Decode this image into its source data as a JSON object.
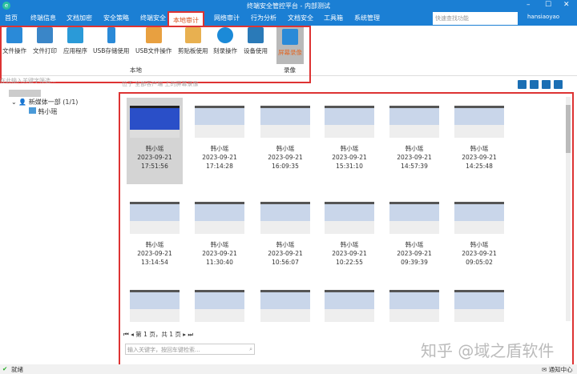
{
  "title": "终端安全管控平台 - 内部测试",
  "window_controls": [
    "–",
    "☐",
    "✕"
  ],
  "menu": [
    "首页",
    "终端信息",
    "文档加密",
    "安全策略",
    "终端安全",
    "本地审计",
    "网络审计",
    "行为分析",
    "文档安全",
    "工具箱",
    "系统管理"
  ],
  "active_menu": "本地审计",
  "search_placeholder": "快速查找功能",
  "user": "hansiaoyao",
  "ribbon": {
    "items": [
      {
        "label": "文件操作",
        "color": "#2a8ad8"
      },
      {
        "label": "文件打印",
        "color": "#3a86c8"
      },
      {
        "label": "应用程序",
        "color": "#2a9ad8"
      },
      {
        "label": "USB存储使用",
        "color": "#2a8ad8"
      },
      {
        "label": "USB文件操作",
        "color": "#e8a040"
      },
      {
        "label": "剪贴板使用",
        "color": "#e8b050"
      },
      {
        "label": "刻录操作",
        "color": "#1b8ad8"
      },
      {
        "label": "设备使用",
        "color": "#2a7ab8"
      }
    ],
    "groups": [
      "本地",
      "录像"
    ],
    "selected": "屏幕录像"
  },
  "filter_placeholder": "在此输入关键字筛选...",
  "breadcrumb": "位于 全部客户端 上的屏幕录像",
  "tree": {
    "group": "新媒体一部 (1/1)",
    "user": "韩小瑶"
  },
  "thumbnails": [
    {
      "name": "韩小瑶",
      "date": "2023-09-21",
      "time": "17:51:56"
    },
    {
      "name": "韩小瑶",
      "date": "2023-09-21",
      "time": "17:14:28"
    },
    {
      "name": "韩小瑶",
      "date": "2023-09-21",
      "time": "16:09:35"
    },
    {
      "name": "韩小瑶",
      "date": "2023-09-21",
      "time": "15:31:10"
    },
    {
      "name": "韩小瑶",
      "date": "2023-09-21",
      "time": "14:57:39"
    },
    {
      "name": "韩小瑶",
      "date": "2023-09-21",
      "time": "14:25:48"
    },
    {
      "name": "韩小瑶",
      "date": "2023-09-21",
      "time": "13:14:54"
    },
    {
      "name": "韩小瑶",
      "date": "2023-09-21",
      "time": "11:30:40"
    },
    {
      "name": "韩小瑶",
      "date": "2023-09-21",
      "time": "10:56:07"
    },
    {
      "name": "韩小瑶",
      "date": "2023-09-21",
      "time": "10:22:55"
    },
    {
      "name": "韩小瑶",
      "date": "2023-09-21",
      "time": "09:39:39"
    },
    {
      "name": "韩小瑶",
      "date": "2023-09-21",
      "time": "09:05:02"
    }
  ],
  "pager": "第 1 页，共 1 页",
  "keyword_placeholder": "输入关键字，按回车键检索...",
  "watermark": "知乎 @域之盾软件",
  "status": "就绪",
  "notification": "通知中心"
}
